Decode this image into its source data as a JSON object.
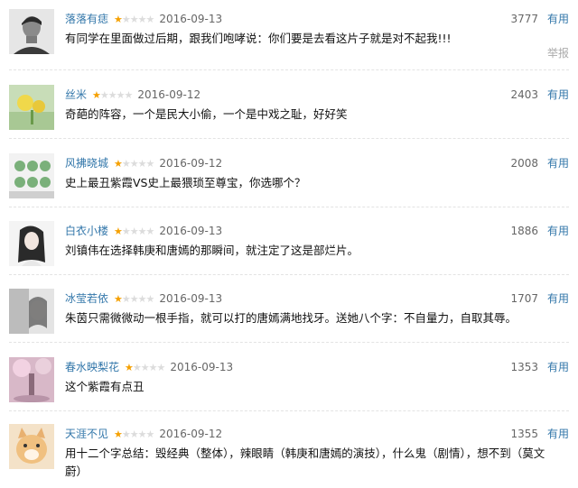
{
  "comments": [
    {
      "user": "落落有痣",
      "stars": 1,
      "date": "2016-09-13",
      "count": "3777",
      "useful": "有用",
      "content": "有同学在里面做过后期，跟我们咆哮说：你们要是去看这片子就是对不起我!!!",
      "report": "举报"
    },
    {
      "user": "丝米",
      "stars": 1,
      "date": "2016-09-12",
      "count": "2403",
      "useful": "有用",
      "content": "奇葩的阵容，一个是民大小偷，一个是中戏之耻，好好笑"
    },
    {
      "user": "风拂晓城",
      "stars": 1,
      "date": "2016-09-12",
      "count": "2008",
      "useful": "有用",
      "content": "史上最丑紫霞VS史上最猥琐至尊宝，你选哪个？"
    },
    {
      "user": "白衣小楼",
      "stars": 1,
      "date": "2016-09-13",
      "count": "1886",
      "useful": "有用",
      "content": "刘镇伟在选择韩庚和唐嫣的那瞬间，就注定了这是部烂片。"
    },
    {
      "user": "冰莹若依",
      "stars": 1,
      "date": "2016-09-13",
      "count": "1707",
      "useful": "有用",
      "content": "朱茵只需微微动一根手指，就可以打的唐嫣满地找牙。送她八个字：不自量力，自取其辱。"
    },
    {
      "user": "春水映梨花",
      "stars": 1,
      "date": "2016-09-13",
      "count": "1353",
      "useful": "有用",
      "content": "这个紫霞有点丑"
    },
    {
      "user": "天涯不见",
      "stars": 1,
      "date": "2016-09-12",
      "count": "1355",
      "useful": "有用",
      "content": "用十二个字总结：毁经典（整体），辣眼睛（韩庚和唐嫣的演技），什么鬼（剧情），想不到（莫文蔚）"
    }
  ]
}
